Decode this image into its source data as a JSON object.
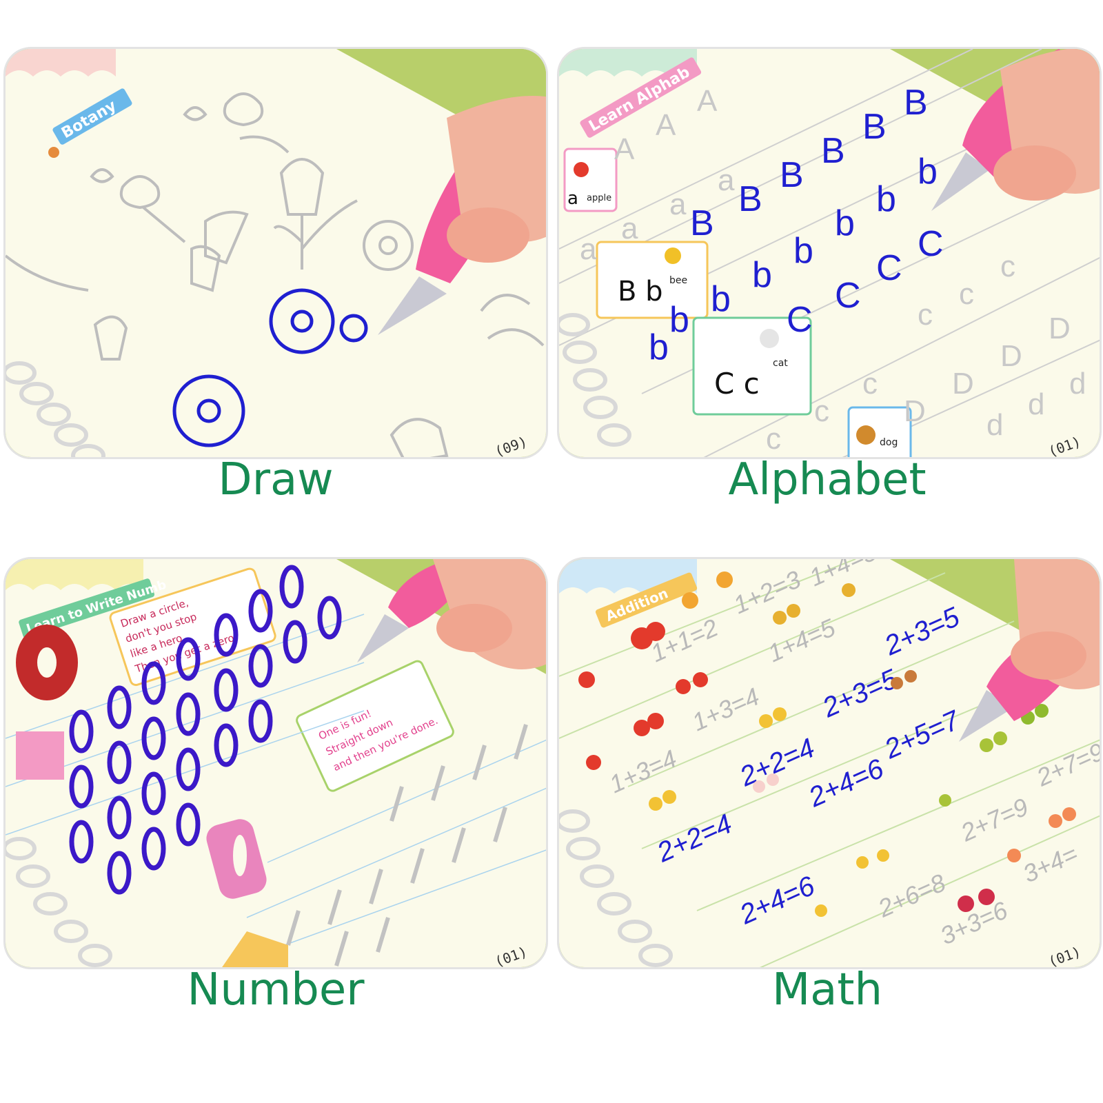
{
  "panels": {
    "draw": {
      "caption": "Draw",
      "section_label": "Botany",
      "page_number": "(09)"
    },
    "alphabet": {
      "caption": "Alphabet",
      "section_label": "Learn Alphab",
      "words": [
        "apple",
        "bee",
        "cat",
        "dog"
      ],
      "page_number": "(01)"
    },
    "number": {
      "caption": "Number",
      "section_label": "Learn to Write Numb",
      "instruction_zero": [
        "Draw a circle,",
        "don't you stop",
        "like a hero.",
        "Then you get a zero."
      ],
      "instruction_one": [
        "One is fun!",
        "Straight down",
        "and then you're done."
      ],
      "page_number": "(01)"
    },
    "math": {
      "caption": "Math",
      "section_label": "Addition",
      "equations": [
        "1+1=2",
        "1+2=3",
        "1+3=4",
        "1+4=5",
        "2+2=4",
        "2+3=5",
        "2+4=6",
        "2+5=7",
        "2+6=8",
        "2+7=9",
        "3+3=6",
        "3+4="
      ],
      "page_number": "(01)"
    }
  },
  "colors": {
    "caption": "#168a52",
    "ink_blue": "#1f1fd0",
    "page": "#fbfaea",
    "cover_green": "#b8cf6a",
    "pen_pink": "#f25c9c"
  }
}
